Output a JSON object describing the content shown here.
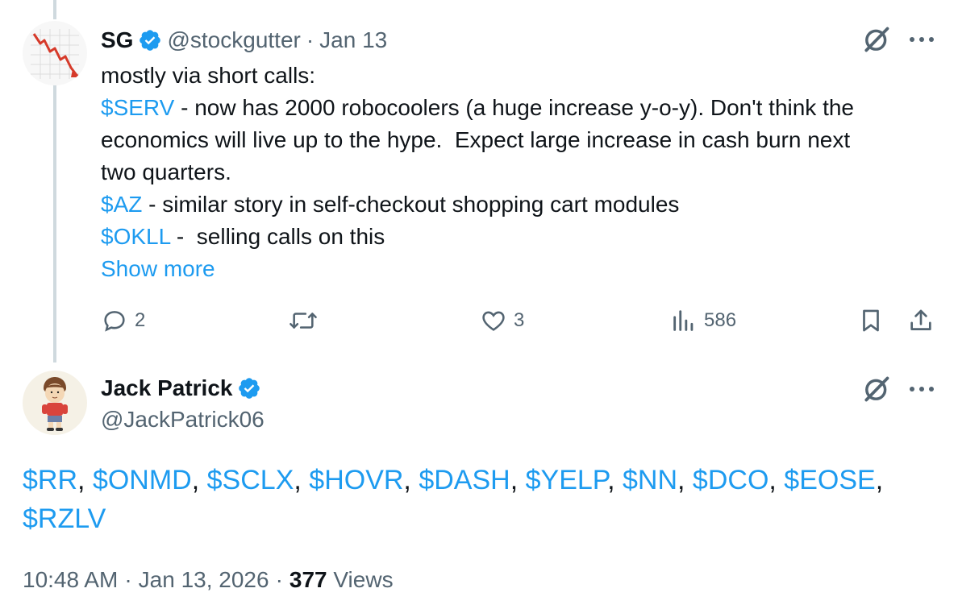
{
  "tweet1": {
    "name": "SG",
    "handle": "@stockgutter",
    "separator": "·",
    "date": "Jan 13",
    "lines": [
      {
        "parts": [
          {
            "text": "mostly via short calls:",
            "link": false
          }
        ]
      },
      {
        "parts": [
          {
            "text": "$SERV",
            "link": true
          },
          {
            "text": " - now has 2000 robocoolers (a huge increase y-o-y). Don't think the",
            "link": false
          }
        ]
      },
      {
        "parts": [
          {
            "text": "economics will live up to the hype.  Expect large increase in cash burn next",
            "link": false
          }
        ]
      },
      {
        "parts": [
          {
            "text": "two quarters.",
            "link": false
          }
        ]
      },
      {
        "parts": [
          {
            "text": "$AZ",
            "link": true
          },
          {
            "text": " - similar story in self-checkout shopping cart modules",
            "link": false
          }
        ]
      },
      {
        "parts": [
          {
            "text": "$OKLL",
            "link": true
          },
          {
            "text": " -  selling calls on this",
            "link": false
          }
        ]
      }
    ],
    "show_more": "Show more",
    "actions": {
      "reply_count": "2",
      "retweet_count": "",
      "like_count": "3",
      "views_count": "586"
    }
  },
  "tweet2": {
    "name": "Jack Patrick",
    "handle": "@JackPatrick06",
    "lines": [
      {
        "parts": [
          {
            "text": "$RR",
            "link": true
          },
          {
            "text": ", ",
            "link": false
          },
          {
            "text": "$ONMD",
            "link": true
          },
          {
            "text": ", ",
            "link": false
          },
          {
            "text": "$SCLX",
            "link": true
          },
          {
            "text": ", ",
            "link": false
          },
          {
            "text": "$HOVR",
            "link": true
          },
          {
            "text": ", ",
            "link": false
          },
          {
            "text": "$DASH",
            "link": true
          },
          {
            "text": ", ",
            "link": false
          },
          {
            "text": "$YELP",
            "link": true
          },
          {
            "text": ", ",
            "link": false
          },
          {
            "text": "$NN",
            "link": true
          },
          {
            "text": ", ",
            "link": false
          },
          {
            "text": "$DCO",
            "link": true
          },
          {
            "text": ", ",
            "link": false
          },
          {
            "text": "$EOSE",
            "link": true
          },
          {
            "text": ",",
            "link": false
          }
        ]
      },
      {
        "parts": [
          {
            "text": "$RZLV",
            "link": true
          }
        ]
      }
    ],
    "footer": {
      "time": "10:48 AM",
      "sep1": "·",
      "date": "Jan 13, 2026",
      "sep2": "·",
      "views_count": "377",
      "views_label": " Views"
    }
  },
  "colors": {
    "accent": "#1d9bf0",
    "text": "#0f1419",
    "secondary": "#536471",
    "thread_line": "#cfd9de"
  },
  "icons": [
    "verified-badge-icon",
    "grok-icon",
    "more-icon",
    "reply-icon",
    "retweet-icon",
    "like-icon",
    "views-icon",
    "bookmark-icon",
    "share-icon"
  ]
}
